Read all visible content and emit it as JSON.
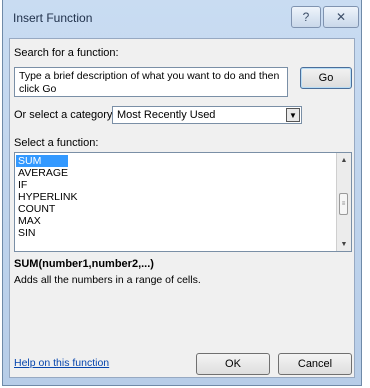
{
  "dialog": {
    "title": "Insert Function",
    "help_glyph": "?",
    "close_glyph": "☒"
  },
  "search": {
    "label": "Search for a function:",
    "value": "Type a brief description of what you want to do and then click Go",
    "go_label": "Go"
  },
  "category": {
    "label": "Or select a category:",
    "selected": "Most Recently Used"
  },
  "functions": {
    "label": "Select a function:",
    "items": [
      "SUM",
      "AVERAGE",
      "IF",
      "HYPERLINK",
      "COUNT",
      "MAX",
      "SIN"
    ],
    "selected": "SUM"
  },
  "details": {
    "syntax": "SUM(number1,number2,...)",
    "description": "Adds all the numbers in a range of cells."
  },
  "footer": {
    "help_link": "Help on this function",
    "ok_label": "OK",
    "cancel_label": "Cancel"
  }
}
